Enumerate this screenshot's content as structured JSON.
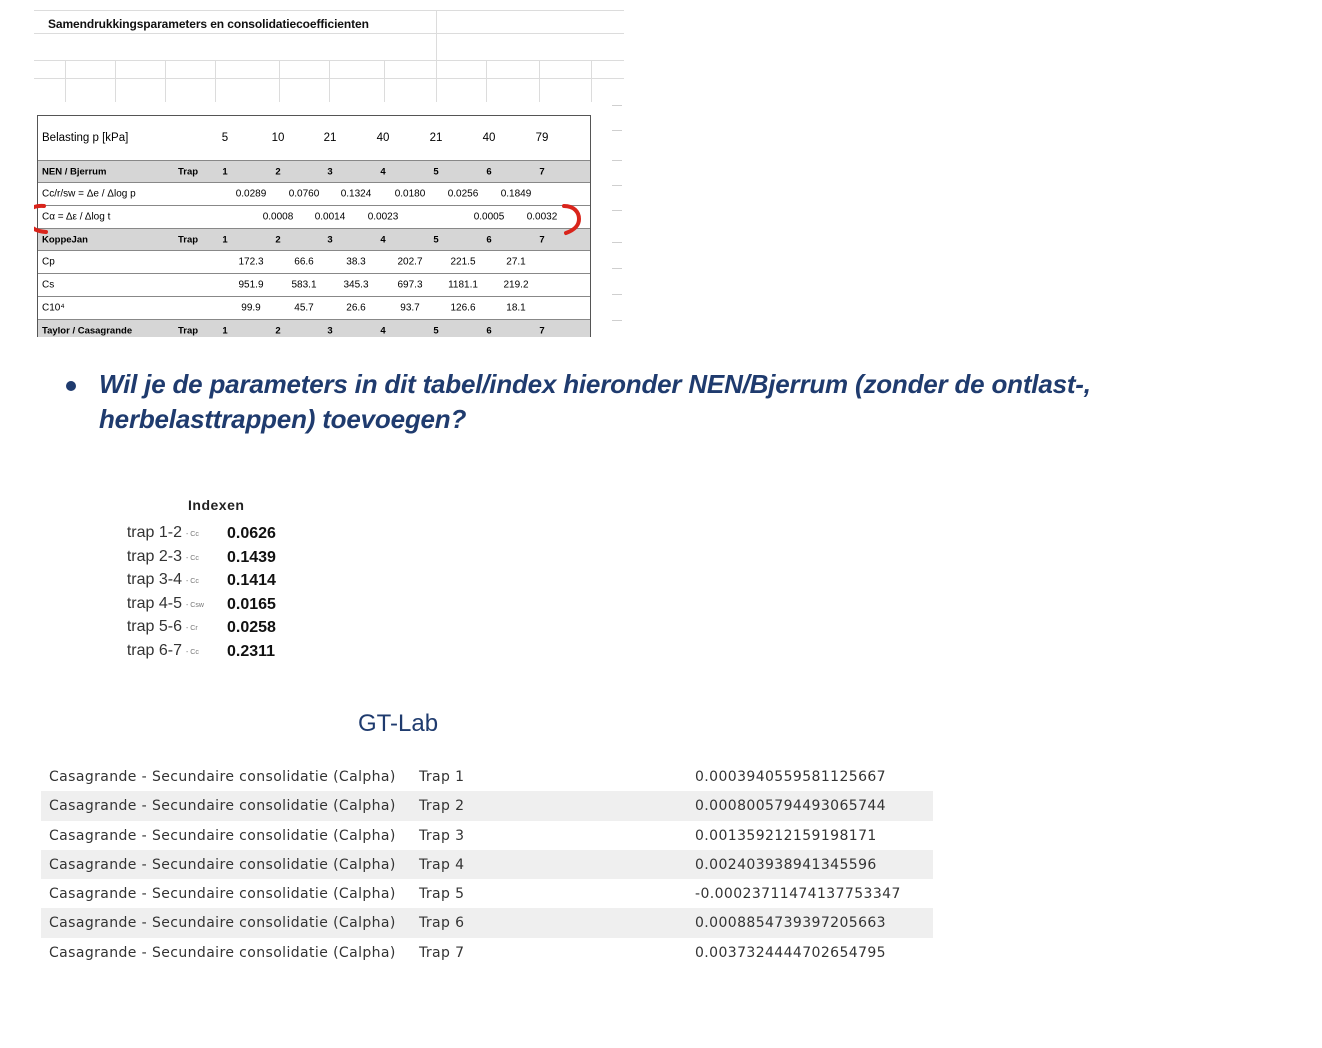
{
  "sheet": {
    "title": "Samendrukkingsparameters en consolidatiecoefficienten",
    "load_label": "Belasting p [kPa]",
    "loads": [
      "5",
      "10",
      "21",
      "40",
      "21",
      "40",
      "79"
    ],
    "sections": [
      {
        "name": "NEN / Bjerrum",
        "trap_label": "Trap",
        "steps": [
          "1",
          "2",
          "3",
          "4",
          "5",
          "6",
          "7"
        ],
        "rows": [
          {
            "label": "Cc/r/sw = Δe / Δlog p",
            "values": [
              "0.0289",
              "0.0760",
              "0.1324",
              "0.0180",
              "0.0256",
              "0.1849"
            ]
          },
          {
            "label": "Cα = Δε / Δlog t",
            "values": [
              "0.0008",
              "0.0014",
              "0.0023",
              "",
              "0.0005",
              "0.0032"
            ]
          }
        ]
      },
      {
        "name": "KoppeJan",
        "trap_label": "Trap",
        "steps": [
          "1",
          "2",
          "3",
          "4",
          "5",
          "6",
          "7"
        ],
        "rows": [
          {
            "label": "Cp",
            "values": [
              "172.3",
              "66.6",
              "38.3",
              "202.7",
              "221.5",
              "27.1"
            ]
          },
          {
            "label": "Cs",
            "values": [
              "951.9",
              "583.1",
              "345.3",
              "697.3",
              "1181.1",
              "219.2"
            ]
          },
          {
            "label": "C10⁴",
            "values": [
              "99.9",
              "45.7",
              "26.6",
              "93.7",
              "126.6",
              "18.1"
            ]
          }
        ]
      },
      {
        "name": "Taylor / Casagrande",
        "trap_label": "Trap",
        "steps": [
          "1",
          "2",
          "3",
          "4",
          "5",
          "6",
          "7"
        ]
      }
    ]
  },
  "question": "Wil je de parameters in dit tabel/index hieronder NEN/Bjerrum (zonder de ontlast-, herbelasttrappen) toevoegen?",
  "index": {
    "title": "Indexen",
    "rows": [
      {
        "label": "trap 1-2",
        "symbol": "- Cc",
        "value": "0.0626"
      },
      {
        "label": "trap 2-3",
        "symbol": "- Cc",
        "value": "0.1439"
      },
      {
        "label": "trap 3-4",
        "symbol": "- Cc",
        "value": "0.1414"
      },
      {
        "label": "trap 4-5",
        "symbol": "- Csw",
        "value": "0.0165"
      },
      {
        "label": "trap 5-6",
        "symbol": "- Cr",
        "value": "0.0258"
      },
      {
        "label": "trap 6-7",
        "symbol": "- Cc",
        "value": "0.2311"
      }
    ]
  },
  "gtlab": {
    "title": "GT-Lab",
    "rows": [
      {
        "name": "Casagrande - Secundaire consolidatie (Calpha)",
        "trap": "Trap 1",
        "value": "0.0003940559581125667"
      },
      {
        "name": "Casagrande - Secundaire consolidatie (Calpha)",
        "trap": "Trap 2",
        "value": "0.0008005794493065744"
      },
      {
        "name": "Casagrande - Secundaire consolidatie (Calpha)",
        "trap": "Trap 3",
        "value": "0.001359212159198171"
      },
      {
        "name": "Casagrande - Secundaire consolidatie (Calpha)",
        "trap": "Trap 4",
        "value": "0.002403938941345596"
      },
      {
        "name": "Casagrande - Secundaire consolidatie (Calpha)",
        "trap": "Trap 5",
        "value": "-0.00023711474137753347"
      },
      {
        "name": "Casagrande - Secundaire consolidatie (Calpha)",
        "trap": "Trap 6",
        "value": "0.0008854739397205663"
      },
      {
        "name": "Casagrande - Secundaire consolidatie (Calpha)",
        "trap": "Trap 7",
        "value": "0.0037324444702654795"
      }
    ]
  },
  "colors": {
    "heading": "#1f3b6e",
    "highlight": "#d9241b",
    "header_row": "#d6d6d6",
    "alt_row": "#efefef"
  }
}
